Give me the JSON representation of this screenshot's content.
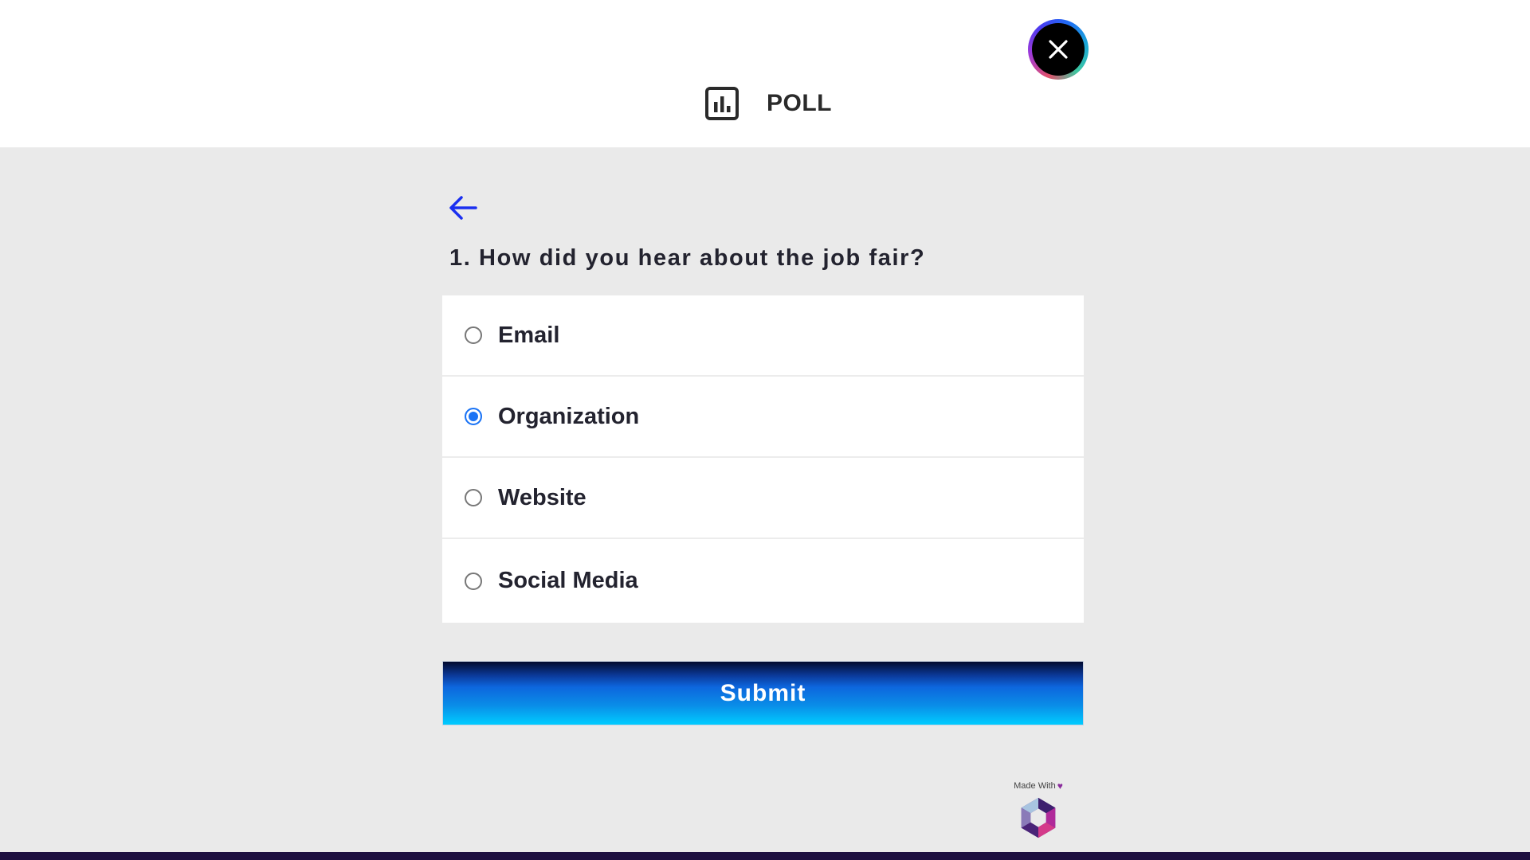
{
  "header": {
    "title": "POLL",
    "title_icon": "bar-chart-icon",
    "close_icon": "close-icon"
  },
  "poll": {
    "back_icon": "arrow-left-icon",
    "question": "1. How did you hear about the job fair?",
    "options": [
      {
        "label": "Email",
        "selected": false
      },
      {
        "label": "Organization",
        "selected": true
      },
      {
        "label": "Website",
        "selected": false
      },
      {
        "label": "Social Media",
        "selected": false
      }
    ],
    "submit_label": "Submit"
  },
  "branding": {
    "made_with_text": "Made With",
    "heart_icon": "heart-icon",
    "logo_icon": "hexagon-cube-logo"
  },
  "colors": {
    "accent_blue": "#1a73f5",
    "back_arrow": "#1a2ff0",
    "footer": "#1e1040",
    "background": "#eaeaea"
  }
}
